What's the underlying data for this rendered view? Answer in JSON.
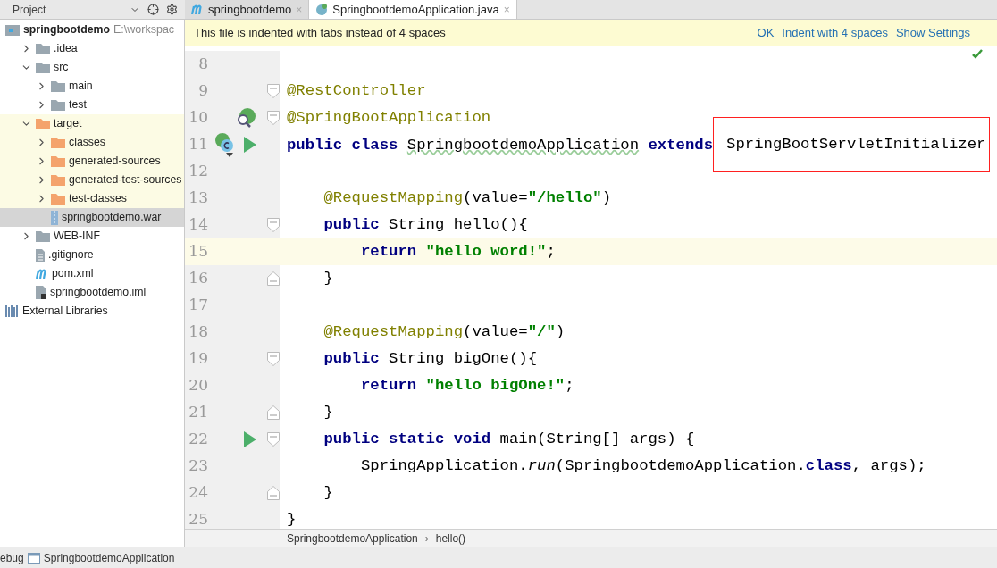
{
  "project_header": {
    "title": "Project"
  },
  "tabs": [
    {
      "label": "springbootdemo",
      "kind": "maven",
      "close": "×",
      "selected": false
    },
    {
      "label": "SpringbootdemoApplication.java",
      "kind": "spring-class",
      "close": "×",
      "selected": true
    }
  ],
  "notification": {
    "text": "This file is indented with tabs instead of 4 spaces",
    "actions": [
      "OK",
      "Indent with 4 spaces",
      "Show Settings"
    ]
  },
  "tree": [
    {
      "label": "springbootdemo",
      "path": "E:\\workspac",
      "kind": "module",
      "selected": false,
      "excluded": false,
      "children": [
        {
          "label": ".idea",
          "kind": "folder",
          "expanded": false,
          "selected": false,
          "excluded": false
        },
        {
          "label": "src",
          "kind": "folder",
          "expanded": true,
          "selected": false,
          "excluded": false,
          "children": [
            {
              "label": "main",
              "kind": "folder",
              "expanded": false,
              "selected": false,
              "excluded": false
            },
            {
              "label": "test",
              "kind": "folder",
              "expanded": false,
              "selected": false,
              "excluded": false
            }
          ]
        },
        {
          "label": "target",
          "kind": "excluded-folder",
          "expanded": true,
          "selected": false,
          "excluded": true,
          "children": [
            {
              "label": "classes",
              "kind": "excluded-folder",
              "expanded": false,
              "selected": false,
              "excluded": true
            },
            {
              "label": "generated-sources",
              "kind": "excluded-folder",
              "expanded": false,
              "selected": false,
              "excluded": true
            },
            {
              "label": "generated-test-sources",
              "kind": "excluded-folder",
              "expanded": false,
              "selected": false,
              "excluded": true
            },
            {
              "label": "test-classes",
              "kind": "excluded-folder",
              "expanded": false,
              "selected": false,
              "excluded": true
            },
            {
              "label": "springbootdemo.war",
              "kind": "war",
              "selected": true
            }
          ]
        },
        {
          "label": "WEB-INF",
          "kind": "folder",
          "expanded": false,
          "selected": false,
          "excluded": false
        },
        {
          "label": ".gitignore",
          "kind": "file",
          "selected": false,
          "excluded": false
        },
        {
          "label": "pom.xml",
          "kind": "maven",
          "selected": false,
          "excluded": false
        },
        {
          "label": "springbootdemo.iml",
          "kind": "iml",
          "selected": false,
          "excluded": false
        }
      ]
    },
    {
      "label": "External Libraries",
      "kind": "libraries",
      "selected": false,
      "excluded": false
    }
  ],
  "code_lines": [
    {
      "number": "8",
      "kind": "top",
      "current": false
    },
    {
      "number": "9",
      "kind": "top",
      "markers": [
        {
          "kind": "fold-start"
        }
      ],
      "tokens": [
        {
          "kind": "annotation",
          "text": "@RestController"
        }
      ],
      "current": false
    },
    {
      "number": "10",
      "kind": "top",
      "markers": [
        {
          "kind": "bean-search"
        },
        {
          "kind": "fold-start"
        }
      ],
      "tokens": [
        {
          "kind": "annotation",
          "text": "@SpringBootApplication"
        }
      ],
      "current": false
    },
    {
      "number": "11",
      "kind": "top",
      "markers": [
        {
          "kind": "bean-class"
        },
        {
          "kind": "run"
        }
      ],
      "tokens": [
        {
          "kind": "keyword",
          "text": "public class "
        },
        {
          "kind": "warning",
          "text": "SpringbootdemoApplication"
        },
        {
          "kind": "keyword",
          "text": " extends"
        },
        {
          "kind": "boxed",
          "text": "SpringBootServletInitializer"
        }
      ],
      "current": false
    },
    {
      "number": "12",
      "kind": "top",
      "current": false
    },
    {
      "number": "13",
      "kind": "member",
      "tokens": [
        {
          "kind": "annotation",
          "text": "@RequestMapping"
        },
        {
          "kind": "plain",
          "text": "(value="
        },
        {
          "kind": "string",
          "text": "\"/hello\""
        },
        {
          "kind": "plain",
          "text": ")"
        }
      ],
      "current": false
    },
    {
      "number": "14",
      "kind": "member",
      "markers": [
        {
          "kind": "fold-start"
        }
      ],
      "tokens": [
        {
          "kind": "keyword",
          "text": "public "
        },
        {
          "kind": "plain",
          "text": "String hello(){"
        }
      ],
      "current": false
    },
    {
      "number": "15",
      "kind": "statement",
      "tokens": [
        {
          "kind": "keyword",
          "text": "return "
        },
        {
          "kind": "string",
          "text": "\"hello word!\""
        },
        {
          "kind": "plain",
          "text": ";"
        }
      ],
      "current": true
    },
    {
      "number": "16",
      "kind": "member",
      "markers": [
        {
          "kind": "fold-end"
        }
      ],
      "tokens": [
        {
          "kind": "plain",
          "text": "}"
        }
      ],
      "current": false
    },
    {
      "number": "17",
      "kind": "top",
      "current": false
    },
    {
      "number": "18",
      "kind": "member",
      "tokens": [
        {
          "kind": "annotation",
          "text": "@RequestMapping"
        },
        {
          "kind": "plain",
          "text": "(value="
        },
        {
          "kind": "string",
          "text": "\"/\""
        },
        {
          "kind": "plain",
          "text": ")"
        }
      ],
      "current": false
    },
    {
      "number": "19",
      "kind": "member",
      "markers": [
        {
          "kind": "fold-start"
        }
      ],
      "tokens": [
        {
          "kind": "keyword",
          "text": "public "
        },
        {
          "kind": "plain",
          "text": "String bigOne(){"
        }
      ],
      "current": false
    },
    {
      "number": "20",
      "kind": "statement",
      "tokens": [
        {
          "kind": "keyword",
          "text": "return "
        },
        {
          "kind": "string",
          "text": "\"hello bigOne!\""
        },
        {
          "kind": "plain",
          "text": ";"
        }
      ],
      "current": false
    },
    {
      "number": "21",
      "kind": "member",
      "markers": [
        {
          "kind": "fold-end"
        }
      ],
      "tokens": [
        {
          "kind": "plain",
          "text": "}"
        }
      ],
      "current": false
    },
    {
      "number": "22",
      "kind": "member",
      "markers": [
        {
          "kind": "run"
        },
        {
          "kind": "fold-start"
        }
      ],
      "tokens": [
        {
          "kind": "keyword",
          "text": "public static void "
        },
        {
          "kind": "plain",
          "text": "main(String[] args) {"
        }
      ],
      "current": false
    },
    {
      "number": "23",
      "kind": "statement",
      "tokens": [
        {
          "kind": "plain",
          "text": "SpringApplication."
        },
        {
          "kind": "static",
          "text": "run"
        },
        {
          "kind": "plain",
          "text": "(SpringbootdemoApplication."
        },
        {
          "kind": "keyword",
          "text": "class"
        },
        {
          "kind": "plain",
          "text": ", args);"
        }
      ],
      "current": false
    },
    {
      "number": "24",
      "kind": "member",
      "markers": [
        {
          "kind": "fold-end"
        }
      ],
      "tokens": [
        {
          "kind": "plain",
          "text": "}"
        }
      ],
      "current": false
    },
    {
      "number": "25",
      "kind": "top",
      "tokens": [
        {
          "kind": "plain",
          "text": "}"
        }
      ],
      "current": false
    }
  ],
  "breadcrumb": {
    "items": [
      "SpringbootdemoApplication",
      "hello()"
    ],
    "separator": "›"
  },
  "status_bar": {
    "tool": "ebug",
    "file": "SpringbootdemoApplication"
  }
}
